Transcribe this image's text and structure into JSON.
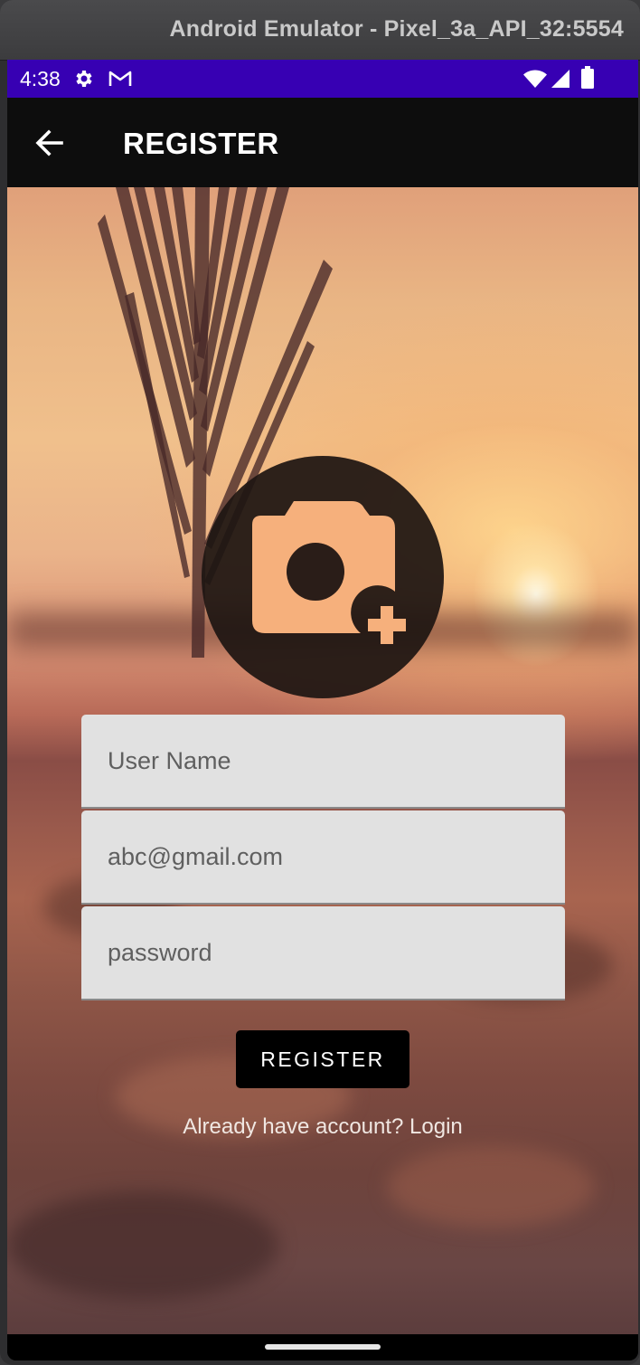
{
  "window": {
    "title": "Android Emulator - Pixel_3a_API_32:5554"
  },
  "status_bar": {
    "time": "4:38",
    "left_icons": [
      "gear-icon",
      "gmail-icon"
    ],
    "right_icons": [
      "wifi-icon",
      "signal-icon",
      "battery-icon"
    ],
    "color": "#3700B3"
  },
  "app_bar": {
    "title": "REGISTER",
    "back_icon": "arrow-back-icon",
    "color": "#0D0D0D"
  },
  "profile_image": {
    "icon": "add-a-photo-icon"
  },
  "form": {
    "username": {
      "placeholder": "User Name",
      "value": ""
    },
    "email": {
      "placeholder": "abc@gmail.com",
      "value": ""
    },
    "password": {
      "placeholder": "password",
      "value": ""
    }
  },
  "register_button": {
    "label": "REGISTER"
  },
  "login_link": {
    "text": "Already have account? Login"
  }
}
